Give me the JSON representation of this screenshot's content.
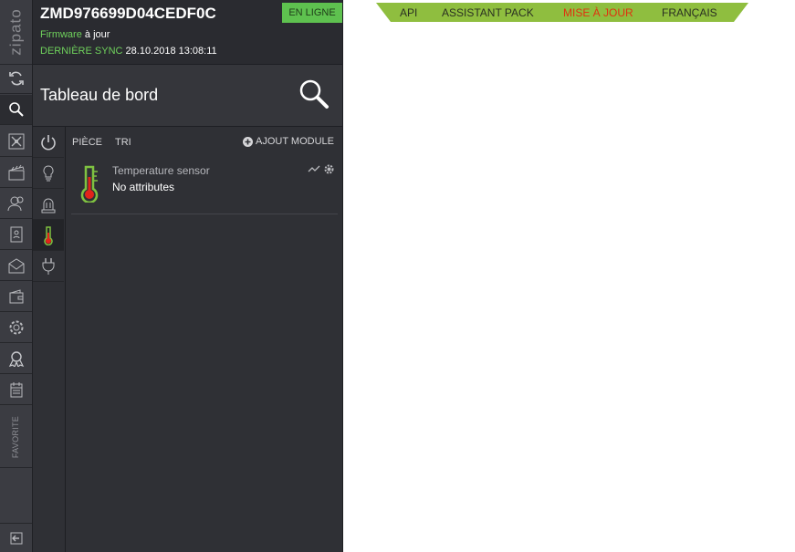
{
  "rail": {
    "logo": "zipato",
    "favorite": "FAVORITE",
    "buttons": [
      "sync-icon",
      "search-icon",
      "network-icon",
      "scenes-icon",
      "users-icon",
      "contacts-icon",
      "mail-icon",
      "wallet-icon",
      "settings-icon",
      "badge-icon",
      "calendar-icon"
    ]
  },
  "header": {
    "device_id": "ZMD976699D04CEDF0C",
    "status": "EN LIGNE",
    "firmware_label": "Firmware",
    "firmware_value": "à jour",
    "sync_label": "DERNIÈRE SYNC",
    "sync_value": "28.10.2018 13:08:11"
  },
  "title": "Tableau de bord",
  "subnav": [
    "power-icon",
    "bulb-icon",
    "alarm-icon",
    "thermometer-icon",
    "plug-icon"
  ],
  "tabs": {
    "room": "PIÈCE",
    "sort": "TRI",
    "add_module": "AJOUT MODULE"
  },
  "devices": [
    {
      "name": "Temperature sensor",
      "attributes": "No attributes"
    }
  ],
  "topnav": {
    "items": [
      "API",
      "ASSISTANT PACK",
      "MISE À JOUR",
      "FRANÇAIS"
    ],
    "highlight": "MISE À JOUR",
    "bar_color": "#8fbe3f",
    "highlight_color": "#e0300f"
  },
  "colors": {
    "online": "#5ec14f",
    "green_text": "#6fd15c"
  }
}
